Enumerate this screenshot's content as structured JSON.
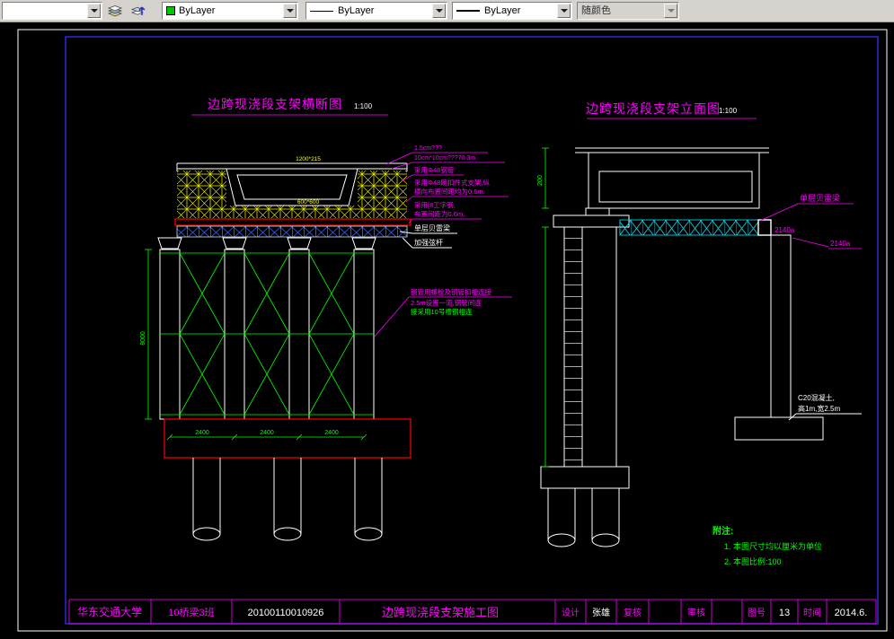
{
  "toolbar": {
    "layer_value": "",
    "color_value": "ByLayer",
    "linetype_value": "ByLayer",
    "lineweight_value": "ByLayer",
    "plotstyle_value": "随颜色"
  },
  "colors": {
    "magenta": "#ff00ff",
    "green": "#00ff00",
    "yellow": "#ffff00",
    "cyan": "#00ffff",
    "red": "#ff0000",
    "white": "#ffffff",
    "frame_blue": "#2b2bd6",
    "toolbar_gray": "#d6d3ce",
    "color_swatch": "#00c800",
    "canvas_bg": "#000000"
  },
  "cross_section": {
    "title": "边跨现浇段支架横断图",
    "scale": "1:100",
    "deck_dim": "1200*215",
    "box_dim": "600*600",
    "ann_plank": "1.5cm???",
    "ann_timber": "10cm*10cm???70.3m",
    "ann_pipe": "采用Φ48钢管",
    "ann_scaffold_1": "采用Φ48碗扣件式支架,纵",
    "ann_scaffold_2": "横向布置间距均为0.6m.",
    "ann_ibeam_1": "采用[8工字钢,",
    "ann_ibeam_2": "布置间距为0.6m.",
    "ann_bailey": "单层贝雷梁",
    "ann_chord": "加强弦杆",
    "ann_brace_1": "钢管用螺栓及钢管扣相连接",
    "ann_brace_2": "2.5m设置一道,钢管间连",
    "ann_brace_3": "接采用10号槽钢相连",
    "dim_height": "8000",
    "dim_span": "2400"
  },
  "elevation": {
    "title": "边跨现浇段支架立面图",
    "scale": "1:100",
    "ann_bailey": "单层贝雷梁",
    "ann_beam_a": "2140a",
    "ann_beam_b": "2140a",
    "ann_footing_1": "C20混凝土,",
    "ann_footing_2": "高1m,宽2.5m",
    "dim_girder": "200"
  },
  "notes": {
    "heading": "附注:",
    "line1": "1. 本图尺寸均以厘米为单位",
    "line2": "2. 本图比例:100"
  },
  "title_block": {
    "university": "华东交通大学",
    "class_name": "10桥梁3班",
    "student_id": "20100110010926",
    "drawing_title": "边跨现浇段支架施工图",
    "design_label": "设计",
    "designer": "张雄",
    "check_label": "复核",
    "review_label": "审核",
    "sheet_label": "图号",
    "sheet_number": "13",
    "date_label": "时间",
    "date_value": "2014.6."
  }
}
